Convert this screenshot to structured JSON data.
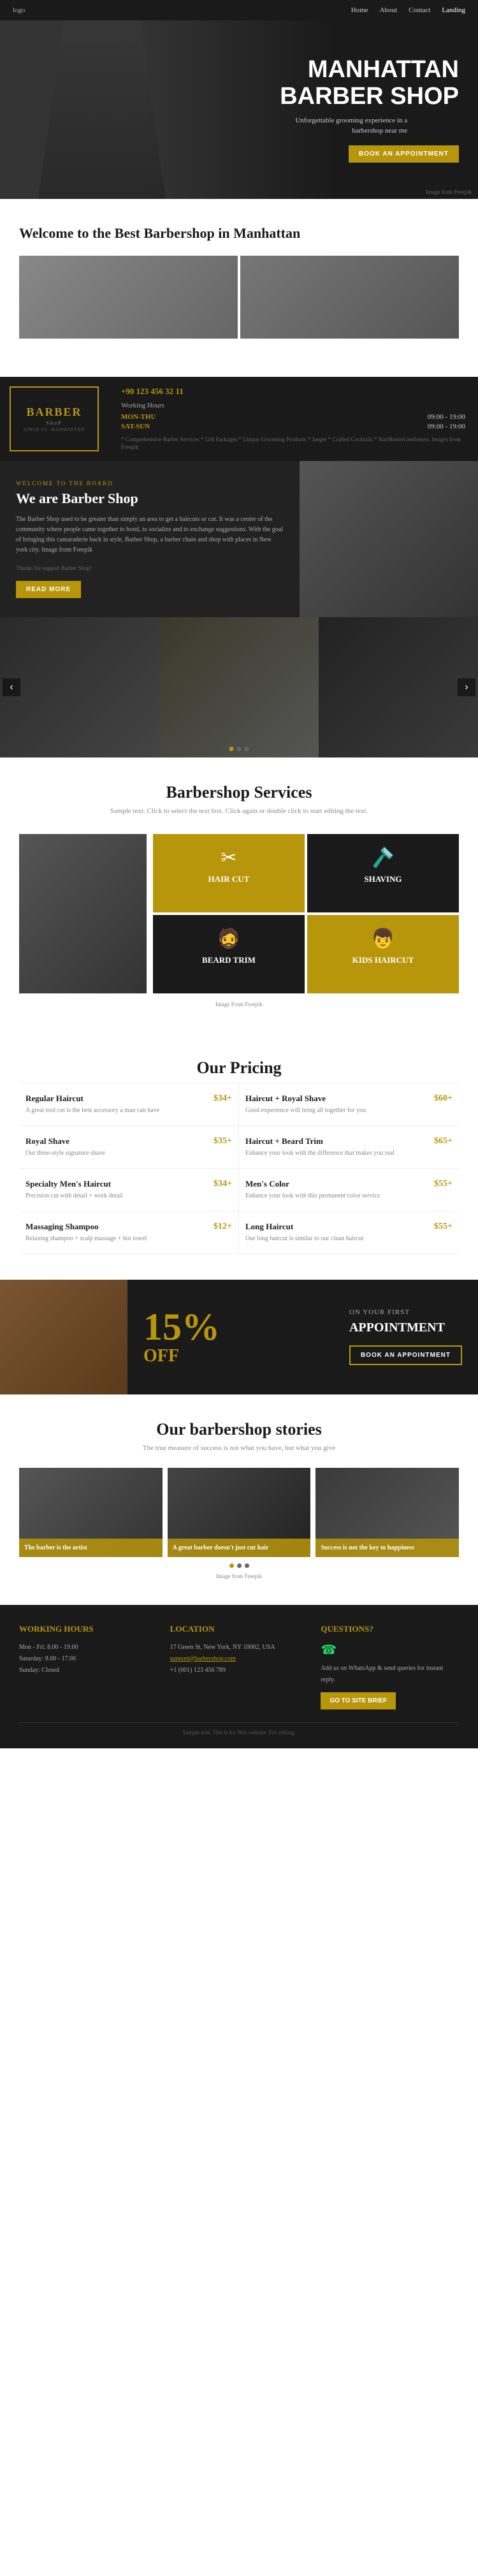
{
  "nav": {
    "logo": "logo",
    "links": [
      "Home",
      "About",
      "Contact",
      "Landing"
    ]
  },
  "hero": {
    "title_line1": "MANHATTAN",
    "title_line2": "BARBER SHOP",
    "subtitle": "Unforgettable grooming experience in a barbershop near me",
    "cta_button": "BOOK AN APPOINTMENT",
    "credit": "Image from Freepik"
  },
  "welcome": {
    "title": "Welcome to the Best Barbershop in Manhattan"
  },
  "barber_info": {
    "logo_line1": "BARBER",
    "logo_line2": "ShoP",
    "logo_sub": "SINCE ST. MANHATTAN",
    "phone": "+90 123 456 32 11",
    "hours_label": "Working Hours",
    "hours": [
      {
        "days": "MON-THU",
        "time": "09:00 - 19:00"
      },
      {
        "days": "SAT-SUN",
        "time": "09:00 - 19:00"
      }
    ],
    "note": "* Comprehensive Barber Services * Gift Packages * Unique Grooming Products * Jaeger * Crafted Cocktails * StarMasterGentlemen. Images from Freepik"
  },
  "we_are": {
    "tag": "WELCOME TO THE BOARD",
    "title": "We are Barber Shop",
    "text": "The Barber Shop used to be greater than simply an area to get a haircuts or cut. It was a center of the community where people came together to bond, to socialize and to exchange suggestions. With the goal of bringing this camaraderie back in style, Barber Shop, a barber chain and shop with places in New york city. Image from Freepik",
    "credit": "Thanks for support Barber Shop!",
    "read_more": "READ MORE"
  },
  "services": {
    "title": "Barbershop Services",
    "subtitle": "Sample text. Click to select the text box. Click again or double click to start editing the text.",
    "items": [
      {
        "name": "Hair Cut",
        "icon": "✂"
      },
      {
        "name": "Shaving",
        "icon": "🪒"
      },
      {
        "name": "Beard Trim",
        "icon": "🧔"
      },
      {
        "name": "Kids Haircut",
        "icon": "👦"
      }
    ],
    "credit": "Image From Freepik"
  },
  "pricing": {
    "title": "Our Pricing",
    "items": [
      {
        "name": "Regular Haircut",
        "price": "$34+",
        "desc": "A great tool cut is the best accessory a man can have"
      },
      {
        "name": "Haircut + Royal Shave",
        "price": "$60+",
        "desc": "Good experience will bring all together for you"
      },
      {
        "name": "Royal Shave",
        "price": "$35+",
        "desc": "Our three-style signature shave"
      },
      {
        "name": "Haircut + Beard Trim",
        "price": "$65+",
        "desc": "Enhance your look with the difference that makes you real"
      },
      {
        "name": "Specialty Men's Haircut",
        "price": "$34+",
        "desc": "Precision cut with detail + work detail"
      },
      {
        "name": "Men's Color",
        "price": "$55+",
        "desc": "Enhance your look with this permanent color service"
      },
      {
        "name": "Massaging Shampoo",
        "price": "$12+",
        "desc": "Relaxing shampoo + scalp massage + hot towel"
      },
      {
        "name": "Long Haircut",
        "price": "$55+",
        "desc": "Our long haircut is similar to our clean haircut"
      }
    ]
  },
  "discount": {
    "percent": "15%",
    "off": "OFF",
    "label": "ON YOUR FIRST",
    "title": "APPOINTMENT",
    "cta": "BOOK AN APPOINTMENT"
  },
  "stories": {
    "title": "Our barbershop stories",
    "subtitle": "The true measure of success is not what you have, but what you give",
    "items": [
      {
        "caption": "The barber is the artist"
      },
      {
        "caption": "A great barber doesn't just cut hair"
      },
      {
        "caption": "Success is not the key to happiness"
      }
    ],
    "credit": "Image from Freepik"
  },
  "footer": {
    "hours_title": "Working Hours",
    "hours": [
      {
        "label": "Mon - Fri:",
        "time": "8.00 - 19.00"
      },
      {
        "label": "Saturday:",
        "time": "8.00 - 17.00"
      },
      {
        "label": "Sunday:",
        "time": "Closed"
      }
    ],
    "location_title": "Location",
    "address": "17 Green St, New York, NY 10002, USA",
    "email": "support@barbershop.com",
    "phone": "+1 (001) 123 456 789",
    "questions_title": "Questions?",
    "questions_text": "Add us on WhatsApp & send queries for instant reply.",
    "questions_cta": "GO TO SITE BRIEF",
    "bottom": "Sample text. This is for Wix website. For editing."
  }
}
